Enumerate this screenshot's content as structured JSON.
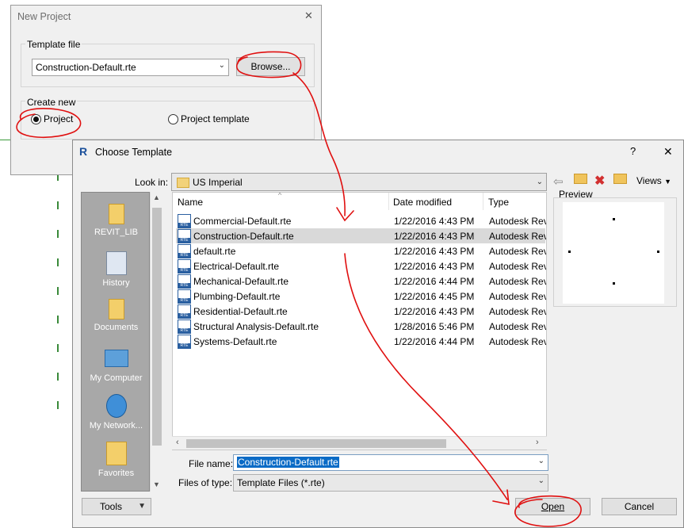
{
  "new_project": {
    "title": "New Project",
    "close": "✕",
    "template_group_label": "Template file",
    "template_value": "Construction-Default.rte",
    "browse_label": "Browse...",
    "create_new_label": "Create new",
    "radio_project": "Project",
    "radio_project_template": "Project template",
    "selected": "Project"
  },
  "choose_template": {
    "title": "Choose Template",
    "app_icon": "R",
    "help": "?",
    "close": "✕",
    "look_in_label": "Look in:",
    "look_in_value": "US Imperial",
    "toolbar": {
      "back_icon": "back-arrow-icon",
      "up_icon": "up-folder-icon",
      "delete_icon": "delete-icon",
      "new_folder_icon": "new-folder-icon",
      "views_label": "Views"
    },
    "places": [
      {
        "label": "REVIT_LIB",
        "icon": "folder-icon"
      },
      {
        "label": "History",
        "icon": "history-icon"
      },
      {
        "label": "Documents",
        "icon": "documents-icon"
      },
      {
        "label": "My Computer",
        "icon": "computer-icon"
      },
      {
        "label": "My Network...",
        "icon": "network-icon"
      },
      {
        "label": "Favorites",
        "icon": "favorites-icon"
      }
    ],
    "columns": {
      "name": "Name",
      "date": "Date modified",
      "type": "Type"
    },
    "files": [
      {
        "name": "Commercial-Default.rte",
        "date": "1/22/2016 4:43 PM",
        "type": "Autodesk Revi"
      },
      {
        "name": "Construction-Default.rte",
        "date": "1/22/2016 4:43 PM",
        "type": "Autodesk Revi"
      },
      {
        "name": "default.rte",
        "date": "1/22/2016 4:43 PM",
        "type": "Autodesk Revi"
      },
      {
        "name": "Electrical-Default.rte",
        "date": "1/22/2016 4:43 PM",
        "type": "Autodesk Revi"
      },
      {
        "name": "Mechanical-Default.rte",
        "date": "1/22/2016 4:44 PM",
        "type": "Autodesk Revi"
      },
      {
        "name": "Plumbing-Default.rte",
        "date": "1/22/2016 4:45 PM",
        "type": "Autodesk Revi"
      },
      {
        "name": "Residential-Default.rte",
        "date": "1/22/2016 4:43 PM",
        "type": "Autodesk Revi"
      },
      {
        "name": "Structural Analysis-Default.rte",
        "date": "1/28/2016 5:46 PM",
        "type": "Autodesk Revi"
      },
      {
        "name": "Systems-Default.rte",
        "date": "1/22/2016 4:44 PM",
        "type": "Autodesk Revi"
      }
    ],
    "selected_file": "Construction-Default.rte",
    "preview_label": "Preview",
    "file_name_label": "File name:",
    "file_name_value": "Construction-Default.rte",
    "files_of_type_label": "Files of type:",
    "files_of_type_value": "Template Files  (*.rte)",
    "tools_label": "Tools",
    "open_label": "Open",
    "cancel_label": "Cancel"
  },
  "colors": {
    "annotation": "#e01010",
    "selection": "#0a6bc6",
    "places_bg": "#a8a8a8"
  }
}
